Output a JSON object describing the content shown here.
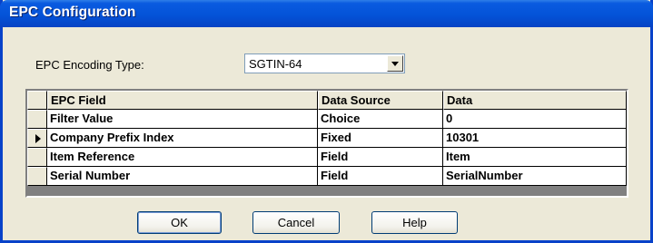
{
  "window": {
    "title": "EPC Configuration"
  },
  "encoding": {
    "label": "EPC Encoding Type:",
    "selected": "SGTIN-64"
  },
  "grid": {
    "headers": [
      "EPC Field",
      "Data Source",
      "Data"
    ],
    "rows": [
      {
        "field": "Filter Value",
        "source": "Choice",
        "data": "0",
        "current": false
      },
      {
        "field": "Company Prefix Index",
        "source": "Fixed",
        "data": "10301",
        "current": true
      },
      {
        "field": "Item Reference",
        "source": "Field",
        "data": "Item",
        "current": false
      },
      {
        "field": "Serial Number",
        "source": "Field",
        "data": "SerialNumber",
        "current": false
      }
    ]
  },
  "buttons": {
    "ok": "OK",
    "cancel": "Cancel",
    "help": "Help"
  },
  "icons": {
    "combo_arrow": "chevron-down-icon",
    "row_indicator": "row-pointer-icon"
  },
  "colors": {
    "titlebar": "#0453d8",
    "window_bg": "#ece9d8",
    "frame": "#0842c9"
  }
}
